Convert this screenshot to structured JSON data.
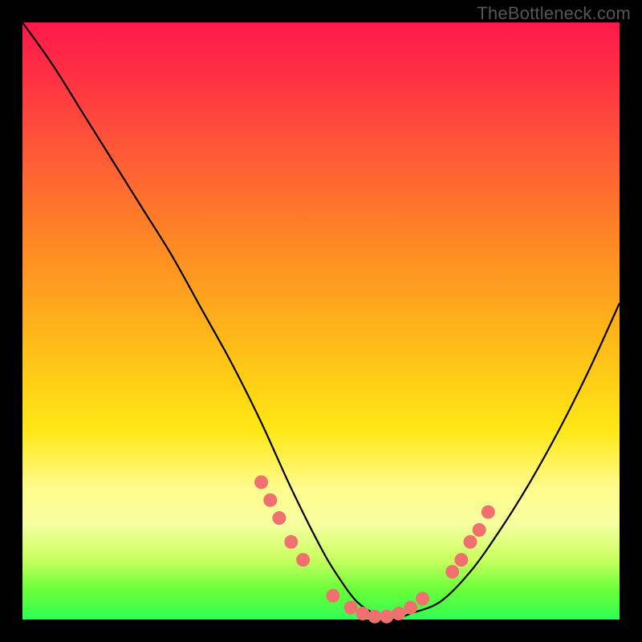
{
  "watermark": "TheBottleneck.com",
  "colors": {
    "marker": "#f07070",
    "curve": "#000000",
    "frame_bg": "#000000"
  },
  "chart_data": {
    "type": "line",
    "title": "",
    "xlabel": "",
    "ylabel": "",
    "xlim": [
      0,
      100
    ],
    "ylim": [
      0,
      100
    ],
    "grid": false,
    "legend": false,
    "series": [
      {
        "name": "bottleneck-curve",
        "x": [
          0,
          5,
          10,
          15,
          20,
          25,
          30,
          35,
          40,
          45,
          50,
          53,
          56,
          59,
          62,
          65,
          70,
          75,
          80,
          85,
          90,
          95,
          100
        ],
        "y": [
          100,
          93,
          85,
          77,
          69,
          61,
          52,
          43,
          33,
          22,
          12,
          7,
          3,
          1,
          0,
          1,
          3,
          8,
          15,
          23,
          32,
          42,
          53
        ]
      }
    ],
    "markers": {
      "name": "highlight-dots",
      "points": [
        {
          "x": 40,
          "y": 23
        },
        {
          "x": 41.5,
          "y": 20
        },
        {
          "x": 43,
          "y": 17
        },
        {
          "x": 45,
          "y": 13
        },
        {
          "x": 47,
          "y": 10
        },
        {
          "x": 52,
          "y": 4
        },
        {
          "x": 55,
          "y": 2
        },
        {
          "x": 57,
          "y": 1
        },
        {
          "x": 59,
          "y": 0.5
        },
        {
          "x": 61,
          "y": 0.5
        },
        {
          "x": 63,
          "y": 1
        },
        {
          "x": 65,
          "y": 2
        },
        {
          "x": 67,
          "y": 3.5
        },
        {
          "x": 72,
          "y": 8
        },
        {
          "x": 73.5,
          "y": 10
        },
        {
          "x": 75,
          "y": 13
        },
        {
          "x": 76.5,
          "y": 15
        },
        {
          "x": 78,
          "y": 18
        }
      ]
    }
  }
}
